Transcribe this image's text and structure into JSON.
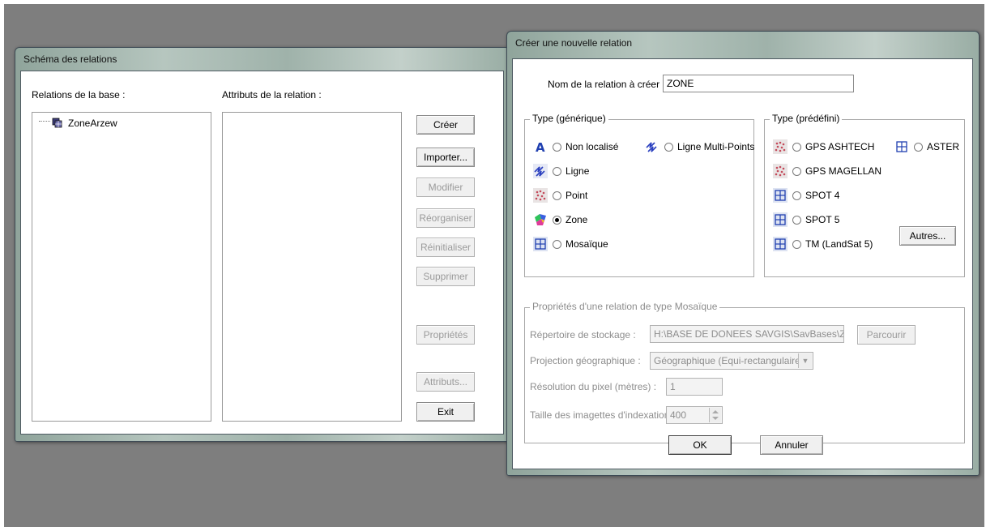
{
  "schema_window": {
    "title": "Schéma des relations",
    "relations_label": "Relations de la base :",
    "attributes_label": "Attributs de la relation :",
    "tree_items": [
      "ZoneArzew"
    ],
    "buttons": {
      "create": "Créer",
      "import": "Importer...",
      "modify": "Modifier",
      "reorganize": "Réorganiser",
      "reinitialize": "Réinitialiser",
      "delete": "Supprimer",
      "properties": "Propriétés",
      "attributes": "Attributs...",
      "exit": "Exit"
    }
  },
  "new_relation_dialog": {
    "title": "Créer une nouvelle relation",
    "name_label": "Nom de la relation à créer :",
    "name_value": "ZONE",
    "generic_type": {
      "legend": "Type (générique)",
      "options": [
        {
          "label": "Non localisé",
          "icon": "text-a-icon",
          "selected": false
        },
        {
          "label": "Ligne Multi-Points",
          "icon": "multiline-icon",
          "selected": false
        },
        {
          "label": "Ligne",
          "icon": "line-icon",
          "selected": false
        },
        {
          "label": "Point",
          "icon": "point-icon",
          "selected": false
        },
        {
          "label": "Zone",
          "icon": "zone-icon",
          "selected": true
        },
        {
          "label": "Mosaïque",
          "icon": "mosaic-icon",
          "selected": false
        }
      ]
    },
    "predefined_type": {
      "legend": "Type (prédéfini)",
      "options": [
        {
          "label": "GPS ASHTECH",
          "icon": "point-icon",
          "selected": false
        },
        {
          "label": "ASTER",
          "icon": "mosaic-icon",
          "selected": false
        },
        {
          "label": "GPS MAGELLAN",
          "icon": "point-icon",
          "selected": false
        },
        {
          "label": "SPOT 4",
          "icon": "mosaic-icon",
          "selected": false
        },
        {
          "label": "SPOT 5",
          "icon": "mosaic-icon",
          "selected": false
        },
        {
          "label": "TM (LandSat 5)",
          "icon": "mosaic-icon",
          "selected": false
        }
      ],
      "others_button": "Autres..."
    },
    "mosaic_props": {
      "legend": "Propriétés d'une relation de type Mosaïque",
      "storage_label": "Répertoire de stockage :",
      "storage_value": "H:\\BASE DE DONEES SAVGIS\\SavBases\\Zone",
      "browse_button": "Parcourir",
      "projection_label": "Projection géographique :",
      "projection_value": "Géographique (Equi-rectangulaire)",
      "resolution_label": "Résolution du pixel (mètres) :",
      "resolution_value": "1",
      "thumb_label": "Taille des imagettes d'indexation :",
      "thumb_value": "400"
    },
    "ok_button": "OK",
    "cancel_button": "Annuler"
  },
  "colors": {
    "desktop": "#7e7e7e",
    "title_glass": "#a8bab2",
    "icon_blue": "#1f3fb0",
    "icon_point": "#c44a5a"
  }
}
